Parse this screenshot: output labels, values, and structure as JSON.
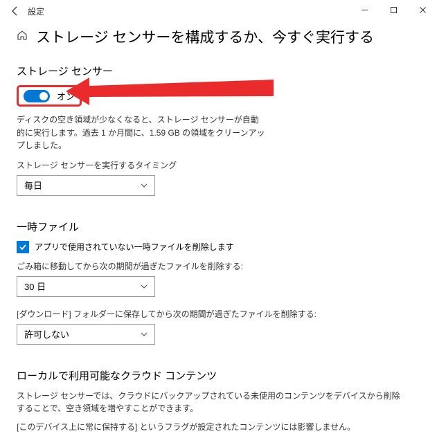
{
  "titlebar": {
    "title": "設定"
  },
  "page": {
    "title": "ストレージ センサーを構成するか、今すぐ実行する"
  },
  "storage_sense": {
    "heading": "ストレージ センサー",
    "toggle_label": "オン",
    "description": "ディスクの空き領域が少なくなると、ストレージ センサーが自動的に実行します。過去 1 か月間に、1.59 GB の領域をクリーンアップしました。",
    "timing_label": "ストレージ センサーを実行するタイミング",
    "timing_value": "毎日"
  },
  "temp_files": {
    "heading": "一時ファイル",
    "checkbox_label": "アプリで使用されていない一時ファイルを削除します",
    "recycle_label": "ごみ箱に移動してから次の期間が過ぎたファイルを削除する:",
    "recycle_value": "30 日",
    "downloads_label": "[ダウンロード] フォルダーに保存してから次の期間が過ぎたファイルを削除する:",
    "downloads_value": "許可しない"
  },
  "cloud": {
    "heading": "ローカルで利用可能なクラウド コンテンツ",
    "description": "ストレージ センサーでは、クラウドにバックアップされている未使用のコンテンツをデバイスから削除することで、空き領域を増やすことができます。",
    "note": "[このデバイス上に常に保持する] というフラグが設定されたコンテンツには影響しません。"
  },
  "colors": {
    "accent": "#0078d4",
    "highlight": "#e92b2b"
  }
}
